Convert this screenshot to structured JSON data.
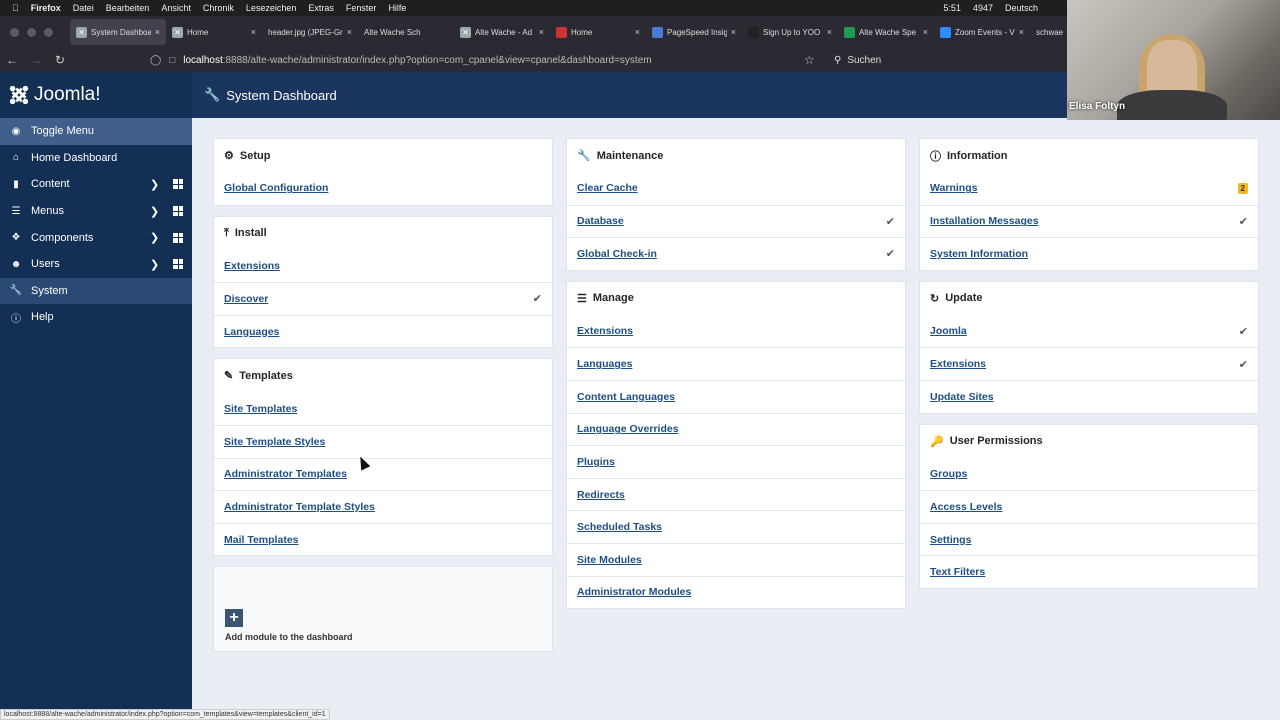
{
  "macmenu": {
    "apple": "",
    "app": "Firefox",
    "items": [
      "Datei",
      "Bearbeiten",
      "Ansicht",
      "Chronik",
      "Lesezeichen",
      "Extras",
      "Fenster",
      "Hilfe"
    ],
    "clock": "5:51",
    "count": "4947",
    "lang": "Deutsch"
  },
  "tabs": [
    {
      "label": "System Dashboard"
    },
    {
      "label": "Home"
    },
    {
      "label": "header.jpg (JPEG-Gr"
    },
    {
      "label": "Alte Wache Sch"
    },
    {
      "label": "Alte Wache - Ad"
    },
    {
      "label": "Home"
    },
    {
      "label": "PageSpeed Insig"
    },
    {
      "label": "Sign Up to YOO"
    },
    {
      "label": "Alte Wache Spe"
    },
    {
      "label": "Zoom Events - V"
    },
    {
      "label": "schwae"
    }
  ],
  "url": {
    "host": "localhost",
    "path": ":8888/alte-wache/administrator/index.php?option=com_cpanel&view=cpanel&dashboard=system",
    "search": "Suchen"
  },
  "sidebar": {
    "logo": "Joomla!",
    "items": [
      {
        "label": "Toggle Menu"
      },
      {
        "label": "Home Dashboard"
      },
      {
        "label": "Content"
      },
      {
        "label": "Menus"
      },
      {
        "label": "Components"
      },
      {
        "label": "Users"
      },
      {
        "label": "System"
      },
      {
        "label": "Help"
      }
    ]
  },
  "header": {
    "title": "System Dashboard"
  },
  "setup": {
    "title": "Setup",
    "links": [
      "Global Configuration"
    ]
  },
  "install": {
    "title": "Install",
    "links": [
      "Extensions",
      "Discover",
      "Languages"
    ]
  },
  "templates": {
    "title": "Templates",
    "links": [
      "Site Templates",
      "Site Template Styles",
      "Administrator Templates",
      "Administrator Template Styles",
      "Mail Templates"
    ]
  },
  "addmodule": {
    "label": "Add module to the dashboard"
  },
  "maintenance": {
    "title": "Maintenance",
    "links": [
      "Clear Cache",
      "Database",
      "Global Check-in"
    ]
  },
  "manage": {
    "title": "Manage",
    "links": [
      "Extensions",
      "Languages",
      "Content Languages",
      "Language Overrides",
      "Plugins",
      "Redirects",
      "Scheduled Tasks",
      "Site Modules",
      "Administrator Modules"
    ]
  },
  "information": {
    "title": "Information",
    "links": [
      "Warnings",
      "Installation Messages",
      "System Information"
    ],
    "warnings_count": "2"
  },
  "update": {
    "title": "Update",
    "links": [
      "Joomla",
      "Extensions",
      "Update Sites"
    ]
  },
  "permissions": {
    "title": "User Permissions",
    "links": [
      "Groups",
      "Access Levels",
      "Settings",
      "Text Filters"
    ]
  },
  "statusbar": "localhost:8888/alte-wache/administrator/index.php?option=com_templates&view=templates&client_id=1",
  "webcam": {
    "name": "Elisa Foltyn"
  }
}
